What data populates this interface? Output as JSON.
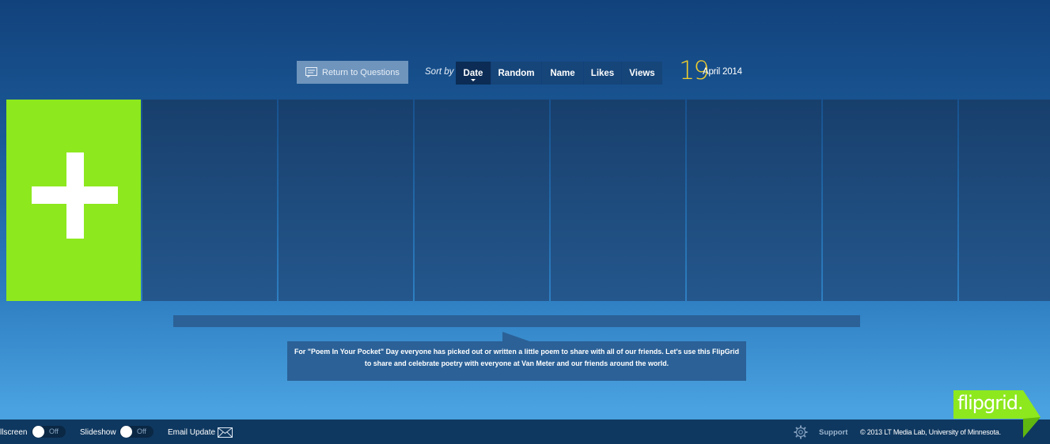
{
  "toolbar": {
    "return_label": "Return to Questions",
    "sort_label": "Sort by",
    "sort_options": [
      "Date",
      "Random",
      "Name",
      "Likes",
      "Views"
    ],
    "active_sort": "Date"
  },
  "date": {
    "day": "19",
    "month_year": "April 2014"
  },
  "add_tile": {
    "icon": "plus-icon",
    "color": "#8de81e"
  },
  "description": "For \"Poem In Your Pocket\" Day everyone has picked out or written a little poem to share with all of our friends.  Let's use this FlipGrid to share and celebrate poetry with everyone at Van Meter and our friends around the world.",
  "footer": {
    "fullscreen_label": "llscreen",
    "fullscreen_state": "Off",
    "slideshow_label": "Slideshow",
    "slideshow_state": "Off",
    "email_label": "Email Update",
    "support_label": "Support",
    "copyright": "© 2013 LT Media Lab, University of Minnesota."
  },
  "logo": {
    "text": "flipgrid.",
    "color": "#8de81e"
  }
}
